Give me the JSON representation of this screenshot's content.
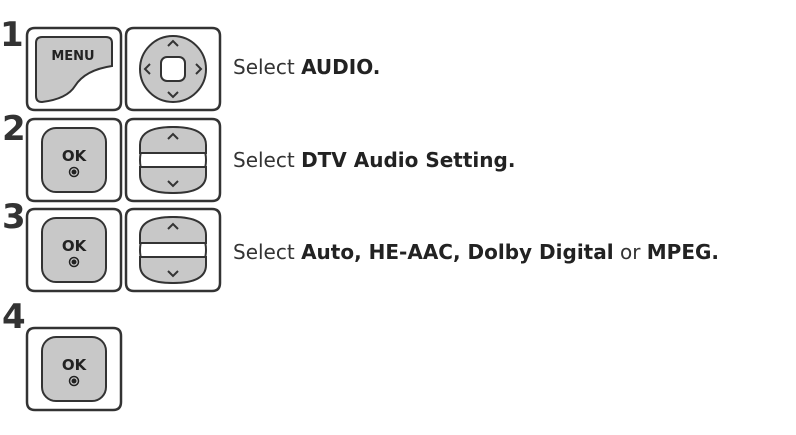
{
  "steps": [
    {
      "number": "1",
      "buttons": [
        "menu-key-icon",
        "four-way-nav-icon"
      ],
      "menu_label": "MENU",
      "instruction": {
        "prefix": "Select ",
        "bold": "AUDIO.",
        "middle": "",
        "bold2": ""
      }
    },
    {
      "number": "2",
      "buttons": [
        "ok-key-icon",
        "up-down-nav-icon"
      ],
      "ok_label": "OK",
      "instruction": {
        "prefix": "Select ",
        "bold": "DTV Audio Setting.",
        "middle": "",
        "bold2": ""
      }
    },
    {
      "number": "3",
      "buttons": [
        "ok-key-icon",
        "up-down-nav-icon"
      ],
      "ok_label": "OK",
      "instruction": {
        "prefix": "Select ",
        "bold": "Auto, HE-AAC, Dolby Digital",
        "middle": " or ",
        "bold2": "MPEG."
      }
    },
    {
      "number": "4",
      "buttons": [
        "ok-key-icon"
      ],
      "ok_label": "OK"
    }
  ]
}
